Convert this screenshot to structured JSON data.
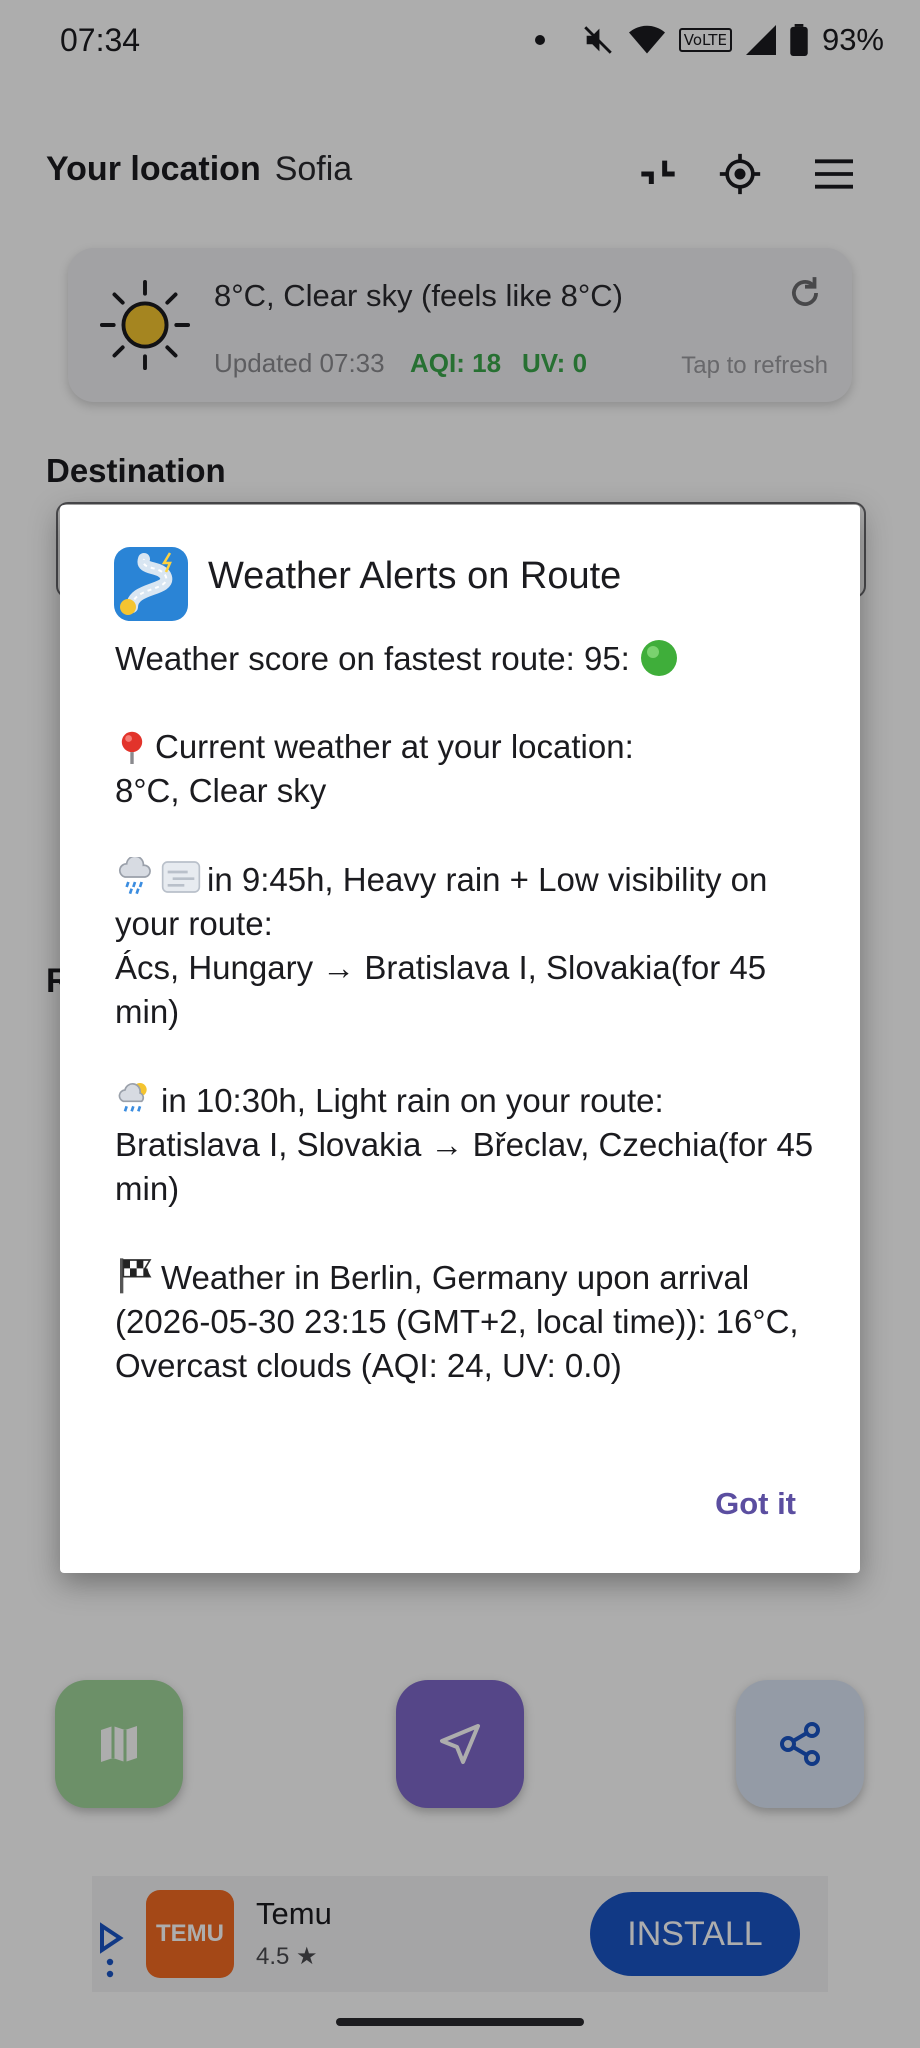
{
  "status_bar": {
    "time": "07:34",
    "network": "VoLTE",
    "battery": "93%"
  },
  "header": {
    "title": "Your location",
    "city": "Sofia"
  },
  "weather_card": {
    "summary": "8°C, Clear sky (feels like 8°C)",
    "updated": "Updated 07:33",
    "aqi": "AQI: 18",
    "uv": "UV: 0",
    "tap_hint": "Tap to refresh"
  },
  "destination": {
    "label": "Destination"
  },
  "partial_label": "R",
  "dialog": {
    "title": "Weather Alerts on Route",
    "line_score": "Weather score on fastest route: 95:",
    "current_label": "Current weather at your location:",
    "current_value": "8°C, Clear sky",
    "alert1_line1": "in 9:45h, Heavy rain + Low visibility on your route:",
    "alert1_line2": "Ács, Hungary → Bratislava I, Slovakia(for 45 min)",
    "alert2_line1": "in 10:30h, Light rain on your route:",
    "alert2_line2": "Bratislava I, Slovakia → Břeclav, Czechia(for 45 min)",
    "arrival_text": "Weather in Berlin, Germany upon arrival (2026-05-30 23:15 (GMT+2, local time)): 16°C, Overcast clouds (AQI: 24, UV: 0.0)",
    "button": "Got it"
  },
  "ad": {
    "logo_text": "TEMU",
    "name": "Temu",
    "rating": "4.5 ★",
    "install": "INSTALL"
  },
  "colors": {
    "accent": "#5b4ea0",
    "good": "#3aa64a",
    "install": "#1a54c4"
  }
}
